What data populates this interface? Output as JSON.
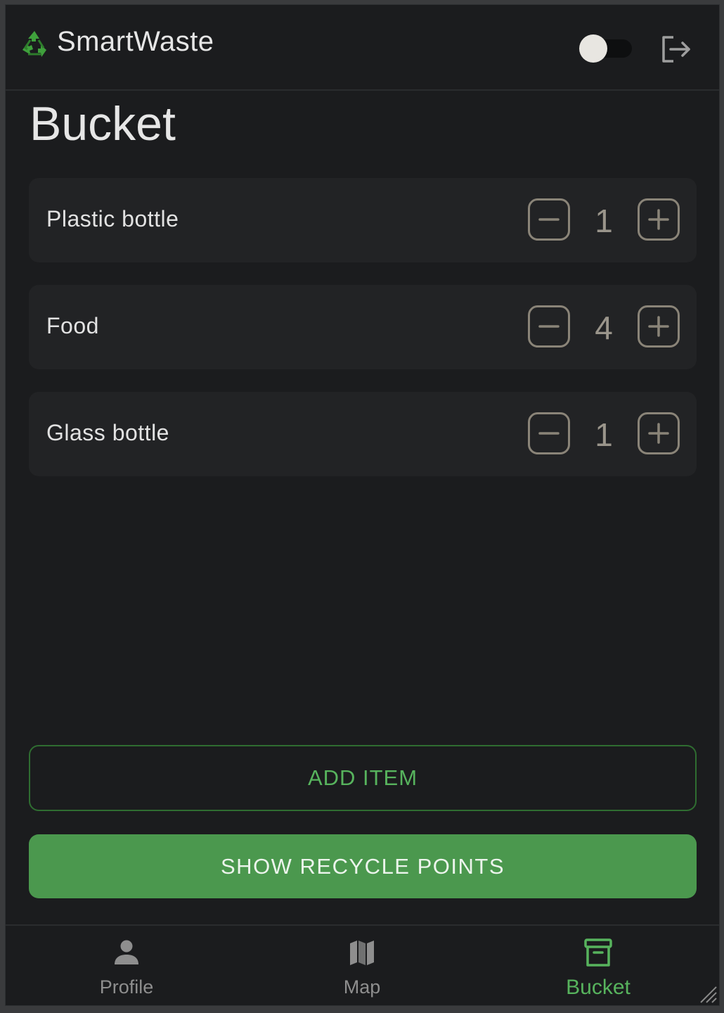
{
  "header": {
    "logo_icon": "recycle-icon",
    "title": "SmartWaste",
    "theme_toggle_on": false,
    "logout_icon": "logout-icon"
  },
  "page": {
    "title": "Bucket"
  },
  "items": [
    {
      "name": "Plastic bottle",
      "quantity": "1"
    },
    {
      "name": "Food",
      "quantity": "4"
    },
    {
      "name": "Glass bottle",
      "quantity": "1"
    }
  ],
  "actions": {
    "add_item": "ADD ITEM",
    "show_recycle_points": "SHOW RECYCLE POINTS"
  },
  "nav": {
    "items": [
      {
        "label": "Profile",
        "icon": "person-icon",
        "active": false
      },
      {
        "label": "Map",
        "icon": "map-icon",
        "active": false
      },
      {
        "label": "Bucket",
        "icon": "archive-icon",
        "active": true
      }
    ]
  },
  "colors": {
    "accent": "#4b984e",
    "accent_text": "#57b35d",
    "background": "#1b1c1e",
    "card": "#222325"
  }
}
